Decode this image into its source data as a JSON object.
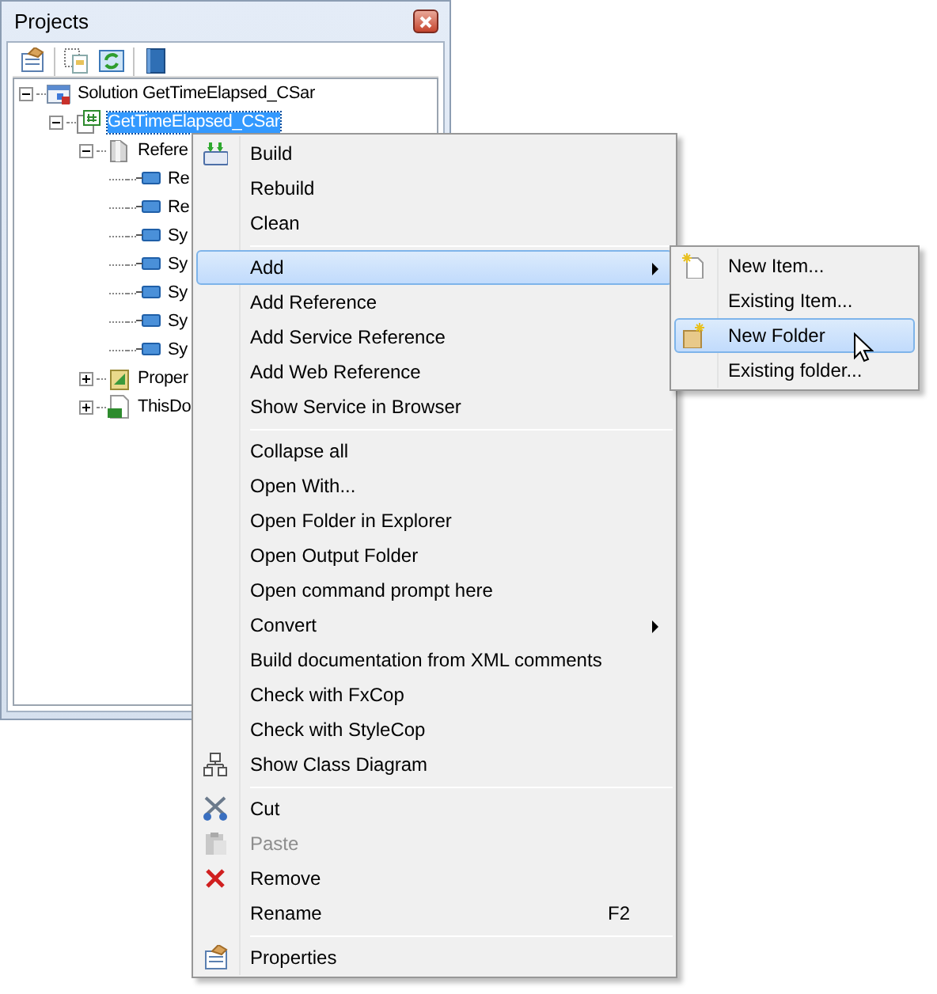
{
  "panel": {
    "title": "Projects"
  },
  "tree": [
    {
      "label": "Solution GetTimeElapsed_CSar",
      "kind": "solution",
      "expanded": true,
      "selected": false,
      "children": [
        {
          "label": "GetTimeElapsed_CSar",
          "kind": "project",
          "expanded": true,
          "selected": true,
          "children": [
            {
              "label": "Refere",
              "kind": "folder",
              "expanded": true,
              "selected": false,
              "children": [
                {
                  "label": "Re",
                  "kind": "reference",
                  "selected": false
                },
                {
                  "label": "Re",
                  "kind": "reference",
                  "selected": false
                },
                {
                  "label": "Sy",
                  "kind": "reference",
                  "selected": false
                },
                {
                  "label": "Sy",
                  "kind": "reference",
                  "selected": false
                },
                {
                  "label": "Sy",
                  "kind": "reference",
                  "selected": false
                },
                {
                  "label": "Sy",
                  "kind": "reference",
                  "selected": false
                },
                {
                  "label": "Sy",
                  "kind": "reference",
                  "selected": false
                }
              ]
            },
            {
              "label": "Proper",
              "kind": "properties",
              "expanded": false,
              "selected": false
            },
            {
              "label": "ThisDo",
              "kind": "file",
              "expanded": false,
              "selected": false
            }
          ]
        }
      ]
    }
  ],
  "context_menu": [
    {
      "kind": "item",
      "label": "Build",
      "selected": false
    },
    {
      "kind": "item",
      "label": "Rebuild",
      "selected": false
    },
    {
      "kind": "item",
      "label": "Clean",
      "selected": false
    },
    {
      "kind": "separator"
    },
    {
      "kind": "submenu",
      "label": "Add",
      "selected": true
    },
    {
      "kind": "item",
      "label": "Add Reference",
      "selected": false
    },
    {
      "kind": "item",
      "label": "Add Service Reference",
      "selected": false
    },
    {
      "kind": "item",
      "label": "Add Web Reference",
      "selected": false
    },
    {
      "kind": "item",
      "label": "Show Service in Browser",
      "selected": false
    },
    {
      "kind": "separator"
    },
    {
      "kind": "item",
      "label": "Collapse all",
      "selected": false
    },
    {
      "kind": "item",
      "label": "Open With...",
      "selected": false
    },
    {
      "kind": "item",
      "label": "Open Folder in Explorer",
      "selected": false
    },
    {
      "kind": "item",
      "label": "Open Output Folder",
      "selected": false
    },
    {
      "kind": "item",
      "label": "Open command prompt here",
      "selected": false
    },
    {
      "kind": "submenu",
      "label": "Convert",
      "selected": false
    },
    {
      "kind": "item",
      "label": "Build documentation from XML comments",
      "selected": false
    },
    {
      "kind": "item",
      "label": "Check with FxCop",
      "selected": false
    },
    {
      "kind": "item",
      "label": "Check with StyleCop",
      "selected": false
    },
    {
      "kind": "item",
      "label": "Show Class Diagram",
      "selected": false
    },
    {
      "kind": "separator"
    },
    {
      "kind": "item",
      "label": "Cut",
      "selected": false
    },
    {
      "kind": "item",
      "label": "Paste",
      "selected": false,
      "disabled": true
    },
    {
      "kind": "item",
      "label": "Remove",
      "selected": false
    },
    {
      "kind": "item",
      "label": "Rename",
      "shortcut": "F2",
      "selected": false
    },
    {
      "kind": "separator"
    },
    {
      "kind": "item",
      "label": "Properties",
      "selected": false
    }
  ],
  "add_submenu": [
    {
      "label": "New Item...",
      "selected": false
    },
    {
      "label": "Existing Item...",
      "selected": false
    },
    {
      "label": "New Folder",
      "selected": true
    },
    {
      "label": "Existing folder...",
      "selected": false
    }
  ]
}
